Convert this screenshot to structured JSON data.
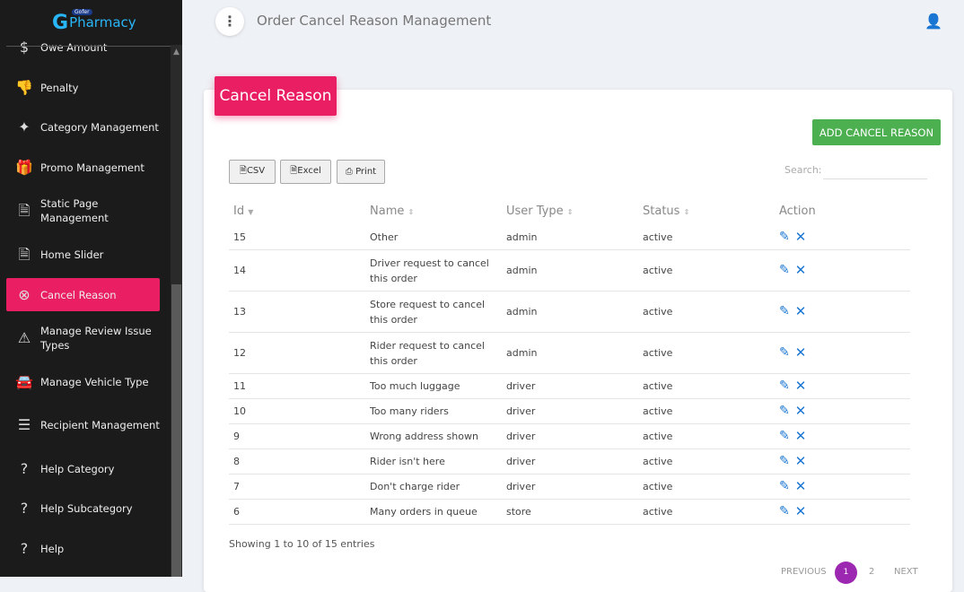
{
  "logo": {
    "badge": "Gofer",
    "text": "Pharmacy"
  },
  "sidebar": {
    "items": [
      {
        "label": "Owe Amount",
        "icon": "dollar-icon",
        "glyph": "$"
      },
      {
        "label": "Penalty",
        "icon": "thumbs-down-icon",
        "glyph": "👎"
      },
      {
        "label": "Category Management",
        "icon": "category-icon",
        "glyph": "✦"
      },
      {
        "label": "Promo Management",
        "icon": "gift-icon",
        "glyph": "🎁"
      },
      {
        "label": "Static Page Management",
        "icon": "document-icon",
        "glyph": "🗎"
      },
      {
        "label": "Home Slider",
        "icon": "document-icon",
        "glyph": "🗎"
      },
      {
        "label": "Cancel Reason",
        "icon": "cancel-icon",
        "glyph": "⊗",
        "active": true
      },
      {
        "label": "Manage Review Issue Types",
        "icon": "warning-icon",
        "glyph": "⚠"
      },
      {
        "label": "Manage Vehicle Type",
        "icon": "car-icon",
        "glyph": "🚘"
      },
      {
        "label": "Recipient Management",
        "icon": "list-icon",
        "glyph": "☰"
      },
      {
        "label": "Help Category",
        "icon": "help-icon",
        "glyph": "?"
      },
      {
        "label": "Help Subcategory",
        "icon": "help-icon",
        "glyph": "?"
      },
      {
        "label": "Help",
        "icon": "help-icon",
        "glyph": "?"
      }
    ]
  },
  "header": {
    "title": "Order Cancel Reason Management"
  },
  "card": {
    "title": "Cancel Reason",
    "add_label": "ADD CANCEL REASON",
    "export": [
      "CSV",
      "Excel",
      "Print"
    ],
    "search_label": "Search:",
    "search_value": ""
  },
  "table": {
    "columns": [
      "Id",
      "Name",
      "User Type",
      "Status",
      "Action"
    ],
    "rows": [
      [
        "15",
        "Other",
        "admin",
        "active"
      ],
      [
        "14",
        "Driver request to cancel this order",
        "admin",
        "active"
      ],
      [
        "13",
        "Store request to cancel this order",
        "admin",
        "active"
      ],
      [
        "12",
        "Rider request to cancel this order",
        "admin",
        "active"
      ],
      [
        "11",
        "Too much luggage",
        "driver",
        "active"
      ],
      [
        "10",
        "Too many riders",
        "driver",
        "active"
      ],
      [
        "9",
        "Wrong address shown",
        "driver",
        "active"
      ],
      [
        "8",
        "Rider isn't here",
        "driver",
        "active"
      ],
      [
        "7",
        "Don't charge rider",
        "driver",
        "active"
      ],
      [
        "6",
        "Many orders in queue",
        "store",
        "active"
      ]
    ]
  },
  "footer": {
    "info": "Showing 1 to 10 of 15 entries",
    "previous": "PREVIOUS",
    "pages": [
      "1",
      "2"
    ],
    "current_page": "1",
    "next": "NEXT"
  },
  "colors": {
    "accent": "#e91e63",
    "add": "#4caf50",
    "page_active": "#9c27b0",
    "sidebar": "#1b1b1b"
  }
}
